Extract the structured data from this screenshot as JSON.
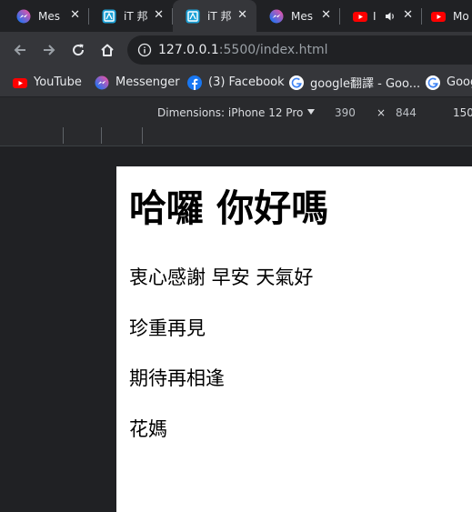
{
  "browser": {
    "tabs": [
      {
        "title": "Mes",
        "icon": "messenger-icon"
      },
      {
        "title": "iT 邦",
        "icon": "ithome-icon"
      },
      {
        "title": "iT 邦",
        "icon": "ithome-icon"
      },
      {
        "title": "Mes",
        "icon": "messenger-icon"
      },
      {
        "title": "I",
        "icon": "youtube-icon",
        "audio": true
      },
      {
        "title": "Mo",
        "icon": "youtube-icon"
      }
    ],
    "close_glyph": "✕",
    "url": {
      "host": "127.0.0.1",
      "rest": ":5500/index.html"
    },
    "bookmarks": [
      {
        "label": "YouTube",
        "icon": "youtube-icon"
      },
      {
        "label": "Messenger",
        "icon": "messenger-icon"
      },
      {
        "label": "(3) Facebook",
        "icon": "facebook-icon"
      },
      {
        "label": "google翻譯 - Goo...",
        "icon": "google-icon"
      },
      {
        "label": "Goog",
        "icon": "google-icon"
      }
    ]
  },
  "devtools": {
    "device_label": "Dimensions: iPhone 12 Pro",
    "width": "390",
    "times": "×",
    "height": "844",
    "zoom": "150"
  },
  "page": {
    "heading": "哈囉 你好嗎",
    "paragraphs": [
      "衷心感謝 早安 天氣好",
      "珍重再見",
      "期待再相逢",
      "花媽"
    ]
  },
  "colors": {
    "youtube": "#ff0000",
    "facebook": "#1877f2",
    "messenger_a": "#a033ff",
    "messenger_b": "#0078ff",
    "ithome": "#1ba1d8"
  }
}
